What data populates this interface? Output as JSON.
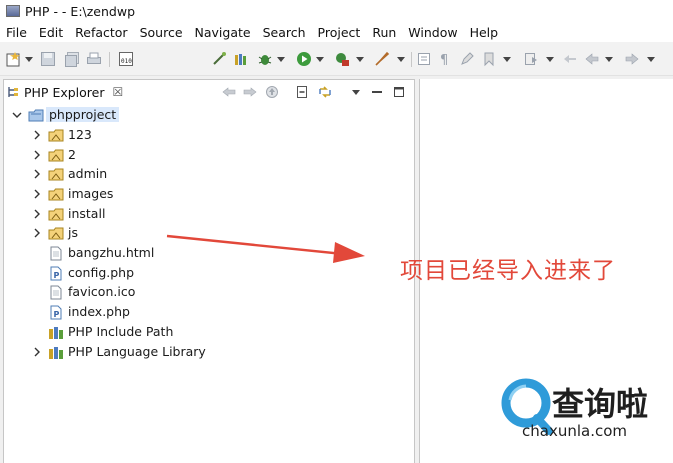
{
  "window": {
    "title": "PHP -  - E:\\zendwp"
  },
  "menubar": {
    "items": [
      "File",
      "Edit",
      "Refactor",
      "Source",
      "Navigate",
      "Search",
      "Project",
      "Run",
      "Window",
      "Help"
    ]
  },
  "explorer": {
    "tab_label": "PHP Explorer",
    "tab_close": "☒",
    "project": "phpproject",
    "items": [
      {
        "label": "123",
        "kind": "folder",
        "expandable": true
      },
      {
        "label": "2",
        "kind": "folder",
        "expandable": true
      },
      {
        "label": "admin",
        "kind": "folder",
        "expandable": true
      },
      {
        "label": "images",
        "kind": "folder",
        "expandable": true
      },
      {
        "label": "install",
        "kind": "folder",
        "expandable": true
      },
      {
        "label": "js",
        "kind": "folder",
        "expandable": true
      },
      {
        "label": "bangzhu.html",
        "kind": "file",
        "expandable": false
      },
      {
        "label": "config.php",
        "kind": "php",
        "expandable": false
      },
      {
        "label": "favicon.ico",
        "kind": "file",
        "expandable": false
      },
      {
        "label": "index.php",
        "kind": "php",
        "expandable": false
      },
      {
        "label": "PHP Include Path",
        "kind": "library",
        "expandable": false
      },
      {
        "label": "PHP Language Library",
        "kind": "library",
        "expandable": true
      }
    ]
  },
  "annotation": {
    "text": "项目已经导入进来了",
    "color": "#e2483a"
  },
  "watermark": {
    "brand": "查询啦",
    "url": "chaxunla.com",
    "accent": "#2f9bd9"
  }
}
